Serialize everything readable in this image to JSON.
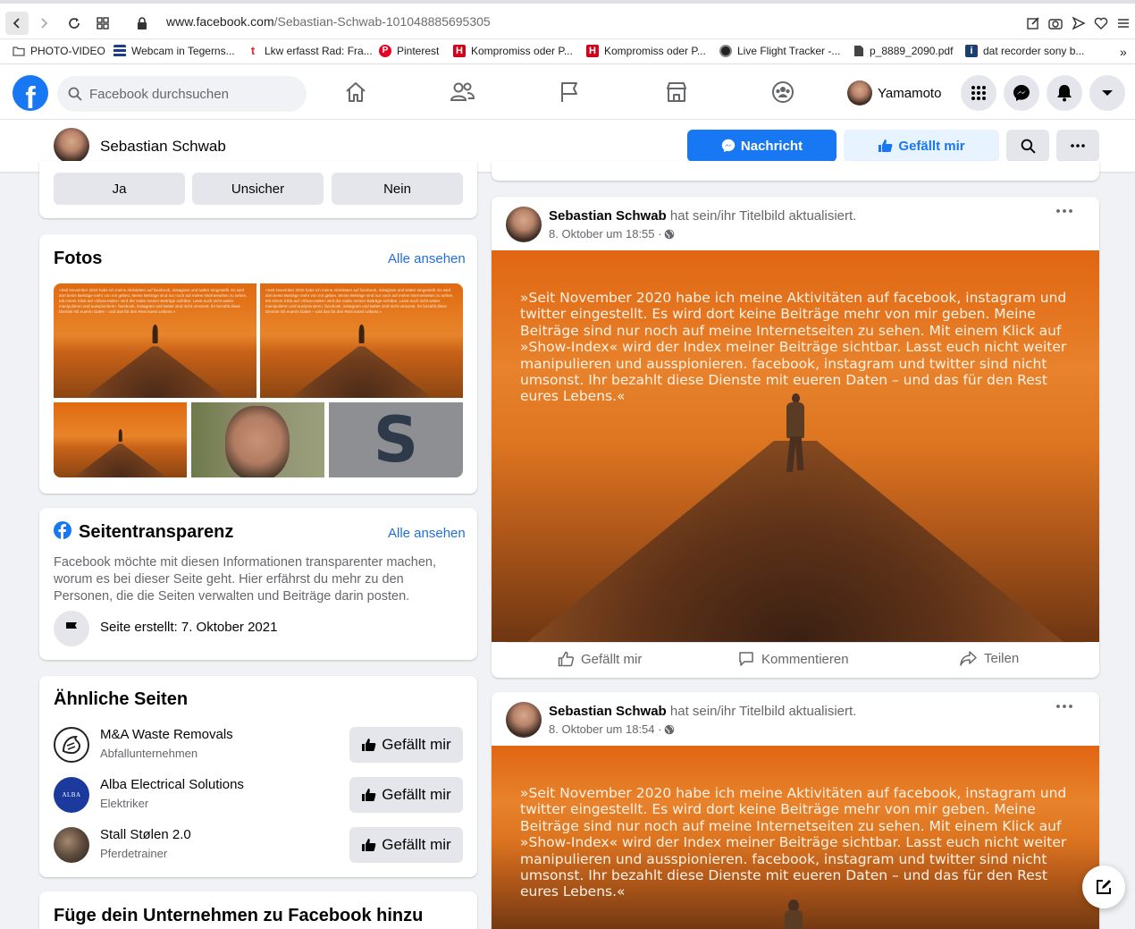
{
  "browser": {
    "url_host": "www.facebook.com",
    "url_path": "/Sebastian-Schwab-101048885695305",
    "bookmarks": [
      {
        "label": "PHOTO-VIDEO",
        "icon": "folder-icon",
        "color": "#555555"
      },
      {
        "label": "Webcam in Tegerns...",
        "icon": "webcam-site-icon",
        "color": "#1a3c8c"
      },
      {
        "label": "Lkw erfasst Rad: Fra...",
        "icon": "news-site-icon",
        "color": "#e0282e"
      },
      {
        "label": "Pinterest",
        "icon": "pinterest-icon",
        "color": "#e60023"
      },
      {
        "label": "Kompromiss oder P...",
        "icon": "h-site-icon",
        "color": "#d0021b"
      },
      {
        "label": "Kompromiss oder P...",
        "icon": "h-site-icon",
        "color": "#d0021b"
      },
      {
        "label": "Live Flight Tracker -...",
        "icon": "flightradar-icon",
        "color": "#222222"
      },
      {
        "label": "p_8889_2090.pdf",
        "icon": "file-icon",
        "color": "#444444"
      },
      {
        "label": "dat recorder sony b...",
        "icon": "info-site-icon",
        "color": "#1c3f6e"
      }
    ],
    "more_bookmarks": "»"
  },
  "nav": {
    "search_placeholder": "Facebook durchsuchen",
    "user_name": "Yamamoto"
  },
  "page_header": {
    "name": "Sebastian Schwab",
    "message_label": "Nachricht",
    "like_label": "Gefällt mir"
  },
  "poll": {
    "options": [
      "Ja",
      "Unsicher",
      "Nein"
    ]
  },
  "photos": {
    "title": "Fotos",
    "see_all": "Alle ansehen",
    "thumb_text": "»Seit November 2020 habe ich meine Aktivitäten auf facebook, instagram und twitter eingestellt. Es wird dort keine Beiträge mehr von mir geben. Meine Beiträge sind nur noch auf meine Internetseiten zu sehen. Mit einem Klick auf »Show-Index« wird der Index meiner Beiträge sichtbar. Lasst euch nicht weiter manipulieren und ausspionieren. facebook, instagram und twitter sind nicht umsonst. Ihr bezahlt diese Dienste mit eueren Daten – und das für den Rest eures Lebens.«",
    "logo_letter": "S"
  },
  "transparency": {
    "title": "Seitentransparenz",
    "see_all": "Alle ansehen",
    "description": "Facebook möchte mit diesen Informationen transparenter machen, worum es bei dieser Seite geht. Hier erfährst du mehr zu den Personen, die die Seiten verwalten und Beiträge darin posten.",
    "created": "Seite erstellt: 7. Oktober 2021"
  },
  "similar": {
    "title": "Ähnliche Seiten",
    "like_label": "Gefällt mir",
    "items": [
      {
        "name": "M&A Waste Removals",
        "category": "Abfallunternehmen"
      },
      {
        "name": "Alba Electrical Solutions",
        "category": "Elektriker",
        "logo_text": "ALBA"
      },
      {
        "name": "Stall Stølen 2.0",
        "category": "Pferdetrainer"
      }
    ]
  },
  "add_business": {
    "title": "Füge dein Unternehmen zu Facebook hinzu"
  },
  "posts": [
    {
      "author": "Sebastian Schwab",
      "action": "hat sein/ihr Titelbild aktualisiert.",
      "time": "8. Oktober um 18:55 ·",
      "quote": "»Seit November 2020 habe ich meine Aktivitäten auf facebook, instagram und twitter eingestellt. Es wird dort keine Beiträge mehr von mir geben. Meine Beiträge sind nur noch auf meine Internetseiten zu sehen. Mit einem Klick auf »Show-Index« wird der Index meiner Beiträge sichtbar. Lasst euch nicht weiter manipulieren und ausspionieren. facebook, instagram und twitter sind nicht umsonst. Ihr bezahlt diese Dienste mit eueren Daten – und das für den Rest eures Lebens.«",
      "like": "Gefällt mir",
      "comment": "Kommentieren",
      "share": "Teilen"
    },
    {
      "author": "Sebastian Schwab",
      "action": "hat sein/ihr Titelbild aktualisiert.",
      "time": "8. Oktober um 18:54 ·",
      "quote": "»Seit November 2020 habe ich meine Aktivitäten auf facebook, instagram und twitter eingestellt. Es wird dort keine Beiträge mehr von mir geben. Meine Beiträge sind nur noch auf meine Internetseiten zu sehen. Mit einem Klick auf »Show-Index« wird der Index meiner Beiträge sichtbar. Lasst euch nicht weiter manipulieren und ausspionieren. facebook, instagram und twitter sind nicht umsonst. Ihr bezahlt diese Dienste mit eueren Daten – und das für den Rest eures Lebens.«"
    }
  ],
  "colors": {
    "brand": "#1877f2",
    "link": "#216fdb",
    "like_button_bg": "#e7f3ff"
  }
}
